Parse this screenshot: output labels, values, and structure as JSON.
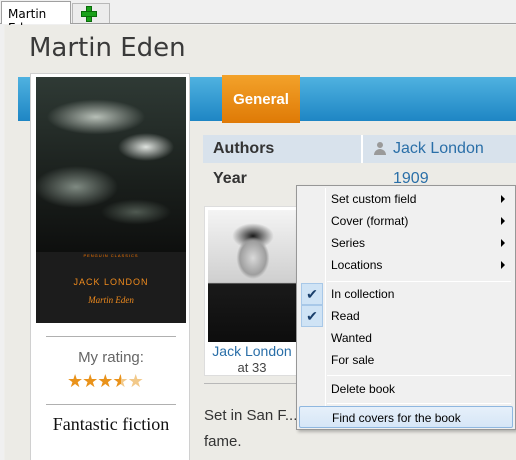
{
  "tabs": {
    "active_label": "Martin Eden",
    "add_tab": "plus-icon"
  },
  "book": {
    "title": "Martin Eden",
    "cover": {
      "publisher_line": "PENGUIN   CLASSICS",
      "author": "JACK LONDON",
      "title": "Martin Eden"
    },
    "rating_label": "My rating:",
    "rating": 3.5,
    "rating_max": 5,
    "shelf": "Fantastic fiction"
  },
  "section_tab": "General",
  "details": {
    "authors_label": "Authors",
    "authors_value": "Jack London",
    "year_label": "Year",
    "year_value": "1909"
  },
  "author_card": {
    "name": "Jack London",
    "age": "at 33"
  },
  "description": {
    "text": "Set in San F... fame."
  },
  "context_menu": {
    "items": [
      {
        "label": "Set custom field",
        "submenu": true
      },
      {
        "label": "Cover (format)",
        "submenu": true
      },
      {
        "label": "Series",
        "submenu": true
      },
      {
        "label": "Locations",
        "submenu": true
      },
      {
        "label": "In collection",
        "checked": true
      },
      {
        "label": "Read",
        "checked": true
      },
      {
        "label": "Wanted",
        "checked": false
      },
      {
        "label": "For sale",
        "checked": false
      },
      {
        "label": "Delete book"
      },
      {
        "label": "Find covers for the book",
        "highlighted": true
      }
    ]
  },
  "colors": {
    "accent_orange": "#e88a10",
    "band_blue": "#2a92cf",
    "link_blue": "#2a6fa8",
    "star": "#e9921a"
  }
}
